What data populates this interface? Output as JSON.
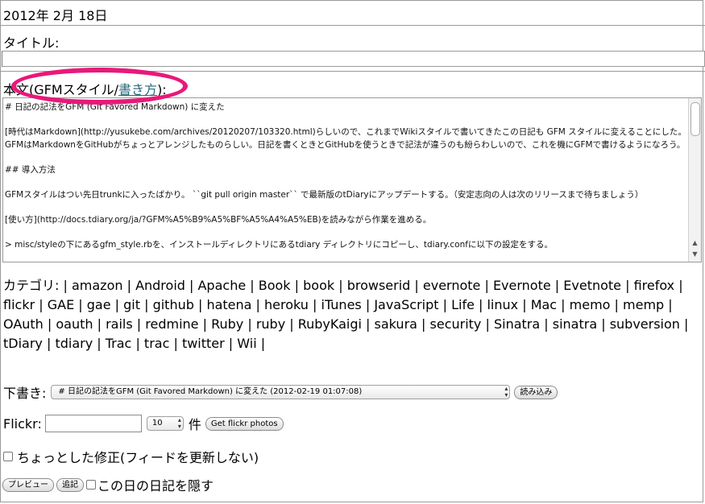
{
  "date": "2012年 2月 18日",
  "title_label": "タイトル:",
  "body_label": {
    "prefix": "本文(GFMスタイル/",
    "link": "書き方",
    "suffix": "):"
  },
  "body_text": [
    "# 日記の記法をGFM (Git Favored Markdown) に変えた",
    "[時代はMarkdown](http://yusukebe.com/archives/20120207/103320.html)らしいので、これまでWikiスタイルで書いてきたこの日記も GFM スタイルに変えることにした。GFMはMarkdownをGitHubがちょっとアレンジしたものらしい。日記を書くときとGitHubを使うときで記法が違うのも紛らわしいので、これを機にGFMで書けるようになろう。",
    "## 導入方法",
    "GFMスタイルはつい先日trunkに入ったばかり。 ``git pull origin master`` で最新版のtDiaryにアップデートする。（安定志向の人は次のリリースまで待ちましょう）",
    "[使い方](http://docs.tdiary.org/ja/?GFM%A5%B9%A5%BF%A5%A4%A5%EB)を読みながら作業を進める。",
    "> misc/styleの下にあるgfm_style.rbを、インストールディレクトリにあるtdiary ディレクトリにコピーし、tdiary.confに以下の設定をする。"
  ],
  "category_label": "カテゴリ:",
  "categories": [
    "amazon",
    "Android",
    "Apache",
    "Book",
    "book",
    "browserid",
    "evernote",
    "Evernote",
    "Evetnote",
    "firefox",
    "flickr",
    "GAE",
    "gae",
    "git",
    "github",
    "hatena",
    "heroku",
    "iTunes",
    "JavaScript",
    "Life",
    "linux",
    "Mac",
    "memo",
    "memp",
    "OAuth",
    "oauth",
    "rails",
    "redmine",
    "Ruby",
    "ruby",
    "RubyKaigi",
    "sakura",
    "security",
    "Sinatra",
    "sinatra",
    "subversion",
    "tDiary",
    "tdiary",
    "Trac",
    "trac",
    "twitter",
    "Wii"
  ],
  "draft": {
    "label": "下書き:",
    "selected": "# 日記の記法をGFM (Git Favored Markdown) に変えた (2012-02-19 01:07:08)",
    "load_button": "読み込み"
  },
  "flickr": {
    "label": "Flickr:",
    "input_value": "",
    "count": "10",
    "unit": "件",
    "button": "Get flickr photos"
  },
  "minor_edit_label": "ちょっとした修正(フィードを更新しない)",
  "actions": {
    "preview": "プレビュー",
    "append": "追記",
    "hide_label": "この日の日記を隠す"
  },
  "colors": {
    "highlight": "#e8197a",
    "link": "#2a6a7a"
  }
}
